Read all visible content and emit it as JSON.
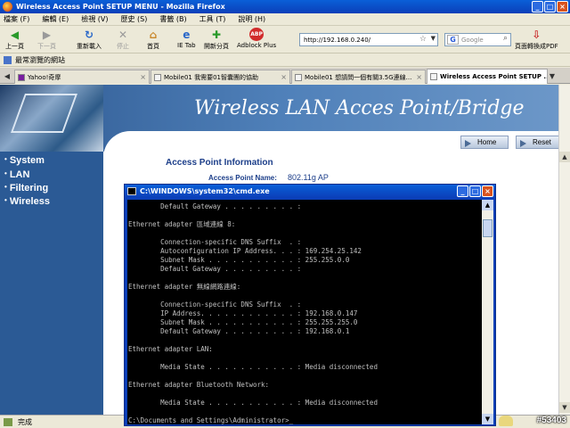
{
  "browser": {
    "title": "Wireless Access Point SETUP MENU - Mozilla Firefox",
    "menu": [
      "檔案 (F)",
      "編輯 (E)",
      "檢視 (V)",
      "歷史 (S)",
      "書籤 (B)",
      "工具 (T)",
      "說明 (H)"
    ],
    "nav": {
      "back": "上一頁",
      "forward": "下一頁",
      "reload": "重新載入",
      "stop": "停止",
      "home": "首頁",
      "ietab": "IE Tab",
      "newtab": "開新分頁",
      "adblock": "Adblock Plus",
      "pdf": "頁面轉換成PDF"
    },
    "url": "http://192.168.0.240/",
    "search_placeholder": "Google",
    "bookmark": "最常瀏覽的網站",
    "tabs": [
      {
        "label": "Yahoo!奇摩"
      },
      {
        "label": "Mobile01 我需要01智囊團的協助"
      },
      {
        "label": "Mobile01 想請問一個有關3.5G連線..."
      },
      {
        "label": "Wireless Access Point SETUP ..."
      }
    ],
    "status": "完成",
    "watermark": "#53403"
  },
  "page": {
    "banner_title": "Wireless LAN Acces Point/Bridge",
    "buttons": {
      "home": "Home",
      "reset": "Reset"
    },
    "sidebar": [
      "System",
      "LAN",
      "Filtering",
      "Wireless"
    ],
    "section_title": "Access Point Information",
    "ap_name_label": "Access Point Name:",
    "ap_name_value": "802.11g AP"
  },
  "cmd": {
    "title": "C:\\WINDOWS\\system32\\cmd.exe",
    "lines": [
      "        Default Gateway . . . . . . . . . :",
      "",
      "Ethernet adapter 區域連線 8:",
      "",
      "        Connection-specific DNS Suffix  . :",
      "        Autoconfiguration IP Address. . . : 169.254.25.142",
      "        Subnet Mask . . . . . . . . . . . : 255.255.0.0",
      "        Default Gateway . . . . . . . . . :",
      "",
      "Ethernet adapter 無線網路連線:",
      "",
      "        Connection-specific DNS Suffix  . :",
      "        IP Address. . . . . . . . . . . . : 192.168.0.147",
      "        Subnet Mask . . . . . . . . . . . : 255.255.255.0",
      "        Default Gateway . . . . . . . . . : 192.168.0.1",
      "",
      "Ethernet adapter LAN:",
      "",
      "        Media State . . . . . . . . . . . : Media disconnected",
      "",
      "Ethernet adapter Bluetooth Network:",
      "",
      "        Media State . . . . . . . . . . . : Media disconnected",
      "",
      "C:\\Documents and Settings\\Administrator>_"
    ]
  }
}
